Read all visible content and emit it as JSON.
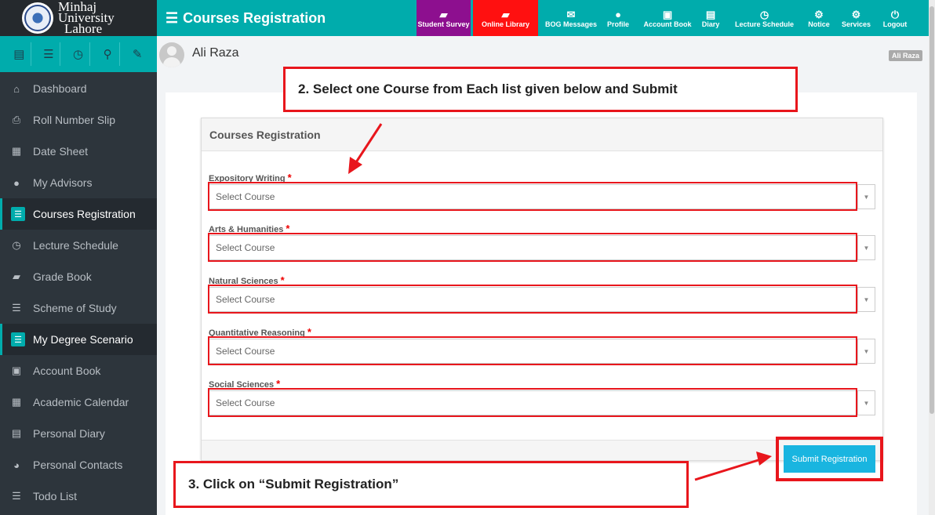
{
  "logo": {
    "line1": "Minhaj",
    "line2": "University",
    "line3": "Lahore"
  },
  "sidebar": {
    "tool_icons": [
      "document-icon",
      "list-icon",
      "clock-icon",
      "sitemap-icon",
      "wrench-icon"
    ],
    "items": [
      {
        "label": "Dashboard",
        "icon": "home-icon",
        "glyph": "⌂"
      },
      {
        "label": "Roll Number Slip",
        "icon": "printer-icon",
        "glyph": "⎙"
      },
      {
        "label": "Date Sheet",
        "icon": "calendar-icon",
        "glyph": "▦"
      },
      {
        "label": "My Advisors",
        "icon": "user-icon",
        "glyph": "●"
      },
      {
        "label": "Courses Registration",
        "icon": "list-icon",
        "glyph": "☰",
        "active": true
      },
      {
        "label": "Lecture Schedule",
        "icon": "clock-icon",
        "glyph": "◷"
      },
      {
        "label": "Grade Book",
        "icon": "book-icon",
        "glyph": "▰"
      },
      {
        "label": "Scheme of Study",
        "icon": "list-icon",
        "glyph": "☰"
      },
      {
        "label": "My Degree Scenario",
        "icon": "list-icon",
        "glyph": "☰",
        "active": true
      },
      {
        "label": "Account Book",
        "icon": "money-icon",
        "glyph": "▣"
      },
      {
        "label": "Academic Calendar",
        "icon": "calendar-icon",
        "glyph": "▦"
      },
      {
        "label": "Personal Diary",
        "icon": "file-icon",
        "glyph": "▤"
      },
      {
        "label": "Personal Contacts",
        "icon": "users-icon",
        "glyph": "◕"
      },
      {
        "label": "Todo List",
        "icon": "list-icon",
        "glyph": "☰"
      }
    ]
  },
  "header": {
    "title": "Courses Registration",
    "nav": [
      {
        "label": "Student Survey",
        "icon": "book-icon",
        "glyph": "▰",
        "color": "purple"
      },
      {
        "label": "Online Library",
        "icon": "book-icon",
        "glyph": "▰",
        "color": "red"
      },
      {
        "label": "BOG Messages",
        "icon": "envelope-icon",
        "glyph": "✉"
      },
      {
        "label": "Profile",
        "icon": "user-icon",
        "glyph": "●"
      },
      {
        "label": "Account Book",
        "icon": "money-icon",
        "glyph": "▣"
      },
      {
        "label": "Diary",
        "icon": "file-icon",
        "glyph": "▤"
      },
      {
        "label": "Lecture Schedule",
        "icon": "clock-icon",
        "glyph": "◷"
      },
      {
        "label": "Notice",
        "icon": "cogs-icon",
        "glyph": "⚙"
      },
      {
        "label": "Services",
        "icon": "cogs-icon",
        "glyph": "⚙"
      },
      {
        "label": "Logout",
        "icon": "power-icon",
        "glyph": "⏻"
      }
    ]
  },
  "user": {
    "name": "Ali Raza",
    "badge": "Ali Raza"
  },
  "registration": {
    "panel_title": "Courses Registration",
    "fields": [
      {
        "label": "Expository Writing",
        "required_mark": "*",
        "placeholder": "Select Course"
      },
      {
        "label": "Arts & Humanities",
        "required_mark": "*",
        "placeholder": "Select Course"
      },
      {
        "label": "Natural Sciences",
        "required_mark": "*",
        "placeholder": "Select Course"
      },
      {
        "label": "Quantitative Reasoning",
        "required_mark": "*",
        "placeholder": "Select Course"
      },
      {
        "label": "Social Sciences",
        "required_mark": "*",
        "placeholder": "Select Course"
      }
    ],
    "submit_label": "Submit Registration"
  },
  "annotations": {
    "step2": "2. Select one Course from Each list given below and Submit",
    "step3": "3. Click on “Submit Registration”"
  },
  "colors": {
    "accent": "#00acac",
    "sidebar_bg": "#2d353c",
    "annotation_red": "#e8161c",
    "submit": "#19b5e0"
  }
}
